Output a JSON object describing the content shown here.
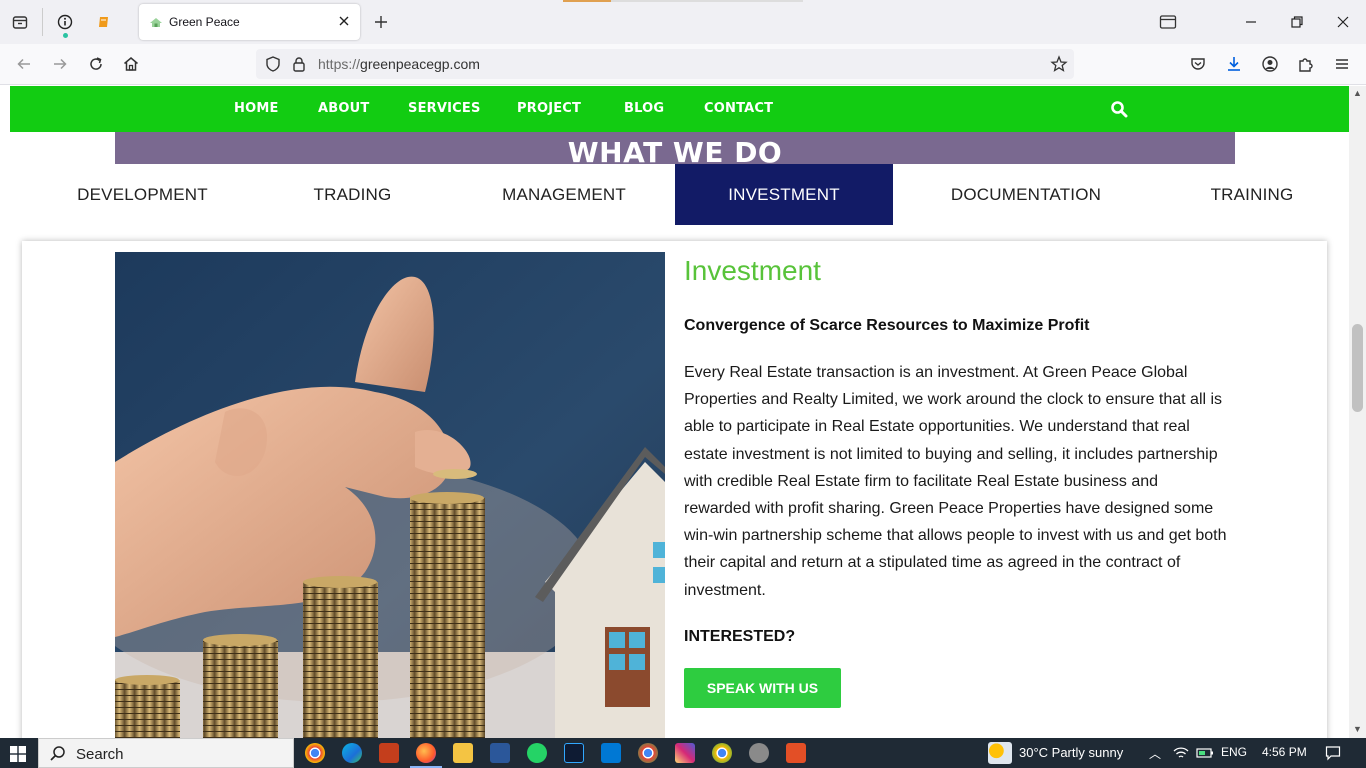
{
  "browser": {
    "tab_title": "Green Peace",
    "url_protocol": "https://",
    "url_host": "greenpeacegp.com"
  },
  "site": {
    "nav": [
      "HOME",
      "ABOUT",
      "SERVICES",
      "PROJECT",
      "BLOG",
      "CONTACT"
    ],
    "section_title": "WHAT WE DO",
    "service_tabs": [
      "DEVELOPMENT",
      "TRADING",
      "MANAGEMENT",
      "INVESTMENT",
      "DOCUMENTATION",
      "TRAINING"
    ],
    "active_tab": "INVESTMENT",
    "content": {
      "title": "Investment",
      "subtitle": "Convergence of Scarce Resources to Maximize Profit",
      "body": "Every Real Estate transaction is an investment. At Green Peace Global Properties and Realty Limited, we work around the clock to ensure that all is able to participate in Real Estate opportunities. We understand that real estate investment is not limited to buying and selling, it includes partnership with credible Real Estate firm to facilitate Real Estate business and rewarded with profit sharing. Green Peace Properties have designed some win-win partnership scheme that allows people to invest with us and get both their capital and return at a stipulated time as agreed in the contract of investment.",
      "interested": "INTERESTED?",
      "cta": "SPEAK WITH US"
    },
    "colors": {
      "nav_green": "#12cc12",
      "heading_purple": "#7a6990",
      "active_tab_navy": "#121b66",
      "title_green": "#58c33a",
      "button_green": "#2ecc40"
    }
  },
  "taskbar": {
    "search_label": "Search",
    "weather": "30°C  Partly sunny",
    "language": "ENG",
    "time": "4:56 PM"
  }
}
